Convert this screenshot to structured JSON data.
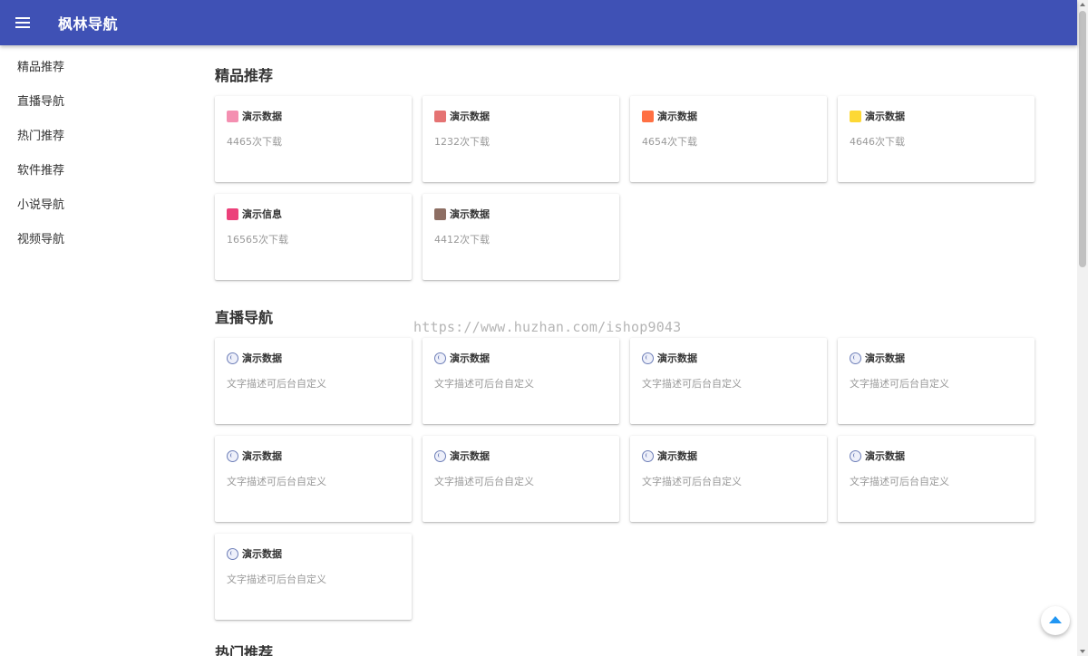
{
  "header": {
    "title": "枫林导航"
  },
  "sidebar": {
    "items": [
      {
        "label": "精品推荐"
      },
      {
        "label": "直播导航"
      },
      {
        "label": "热门推荐"
      },
      {
        "label": "软件推荐"
      },
      {
        "label": "小说导航"
      },
      {
        "label": "视频导航"
      }
    ]
  },
  "sections": [
    {
      "title": "精品推荐",
      "cards": [
        {
          "title": "演示数据",
          "desc": "4465次下载",
          "icon": "app-icon-pink",
          "color": "#f48fb1"
        },
        {
          "title": "演示数据",
          "desc": "1232次下载",
          "icon": "app-icon-avatar",
          "color": "#e57373"
        },
        {
          "title": "演示数据",
          "desc": "4654次下载",
          "icon": "app-icon-orange",
          "color": "#ff7043"
        },
        {
          "title": "演示数据",
          "desc": "4646次下载",
          "icon": "app-icon-yellow",
          "color": "#fdd835"
        },
        {
          "title": "演示信息",
          "desc": "16565次下载",
          "icon": "app-icon-avatar-pink",
          "color": "#ec407a"
        },
        {
          "title": "演示数据",
          "desc": "4412次下载",
          "icon": "app-icon-portrait",
          "color": "#8d6e63"
        }
      ]
    },
    {
      "title": "直播导航",
      "cards": [
        {
          "title": "演示数据",
          "desc": "文字描述可后台自定义",
          "icon": "globe-icon"
        },
        {
          "title": "演示数据",
          "desc": "文字描述可后台自定义",
          "icon": "globe-icon"
        },
        {
          "title": "演示数据",
          "desc": "文字描述可后台自定义",
          "icon": "globe-icon"
        },
        {
          "title": "演示数据",
          "desc": "文字描述可后台自定义",
          "icon": "globe-icon"
        },
        {
          "title": "演示数据",
          "desc": "文字描述可后台自定义",
          "icon": "globe-icon"
        },
        {
          "title": "演示数据",
          "desc": "文字描述可后台自定义",
          "icon": "globe-icon"
        },
        {
          "title": "演示数据",
          "desc": "文字描述可后台自定义",
          "icon": "globe-icon"
        },
        {
          "title": "演示数据",
          "desc": "文字描述可后台自定义",
          "icon": "globe-icon"
        },
        {
          "title": "演示数据",
          "desc": "文字描述可后台自定义",
          "icon": "globe-icon"
        }
      ]
    },
    {
      "title": "热门推荐"
    }
  ],
  "watermark": "https://www.huzhan.com/ishop9043",
  "colors": {
    "header_bg": "#3f51b5",
    "fab_arrow": "#2196f3"
  }
}
